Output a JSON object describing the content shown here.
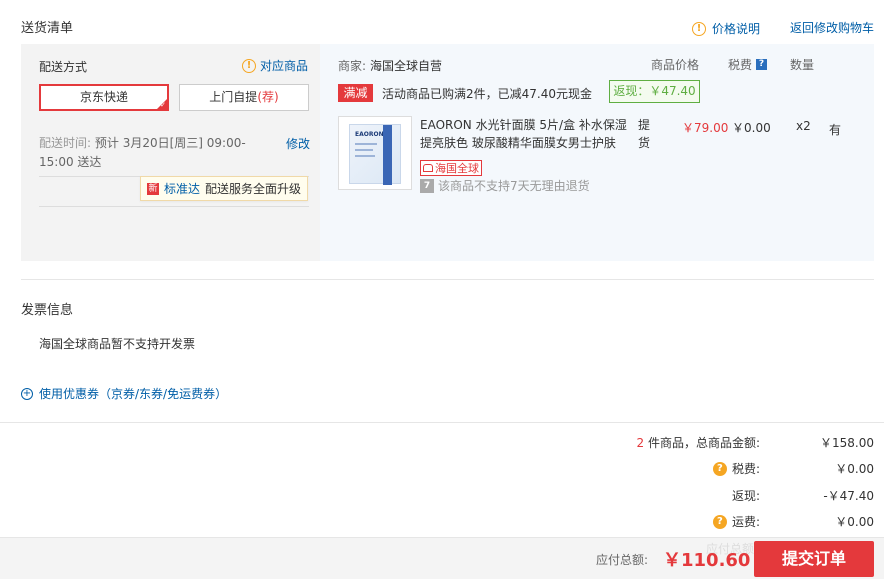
{
  "header": {
    "title": "送货清单",
    "price_info": "价格说明",
    "back_to_cart": "返回修改购物车"
  },
  "delivery": {
    "method_label": "配送方式",
    "match_goods": "对应商品",
    "option_jd": "京东快递",
    "option_pickup": "上门自提",
    "option_pickup_tag": "(荐)",
    "time_label": "配送时间:",
    "time_value": "预计 3月20日[周三] 09:00-15:00 送达",
    "modify": "修改",
    "tip_badge": "新",
    "tip_standard": "标准达",
    "tip_upgrade": "配送服务全面升级"
  },
  "goods_area": {
    "merchant_label": "商家:",
    "merchant_name": "海国全球自营",
    "col_price": "商品价格",
    "col_tax": "税费",
    "col_tax_q": "?",
    "col_qty": "数量",
    "promo_tag": "满减",
    "promo_text": "活动商品已购满2件，已减47.40元现金",
    "rebate": "返现：￥47.40",
    "item": {
      "name": "EAORON 水光针面膜 5片/盒 补水保湿 提亮肤色 玻尿酸精华面膜女男士护肤",
      "thumb_brand": "EAORON",
      "badge": "海国全球",
      "no_return_icon": "7",
      "no_return": "该商品不支持7天无理由退货",
      "tihuo": "提货",
      "price": "￥79.00",
      "tax": "￥0.00",
      "qty": "x2",
      "stock": "有"
    }
  },
  "invoice": {
    "title": "发票信息",
    "text": "海国全球商品暂不支持开发票"
  },
  "coupon": {
    "text": "使用优惠券（京券/东券/免运费券）"
  },
  "summary": {
    "count": "2",
    "count_suffix": "件商品，总商品金额:",
    "total_goods": "￥158.00",
    "tax_label": "税费:",
    "tax_value": "￥0.00",
    "rebate_label": "返现:",
    "rebate_value": "-￥47.40",
    "freight_label": "运费:",
    "freight_value": "￥0.00"
  },
  "bottom": {
    "ghost": "应付总额: ￥110.60",
    "total_label": "应付总额:",
    "total_value": "￥110.60",
    "submit": "提交订单"
  },
  "colors": {
    "accent_red": "#e4393c",
    "link_blue": "#005ea7",
    "green": "#5fae42",
    "warn_orange": "#f5a623"
  }
}
